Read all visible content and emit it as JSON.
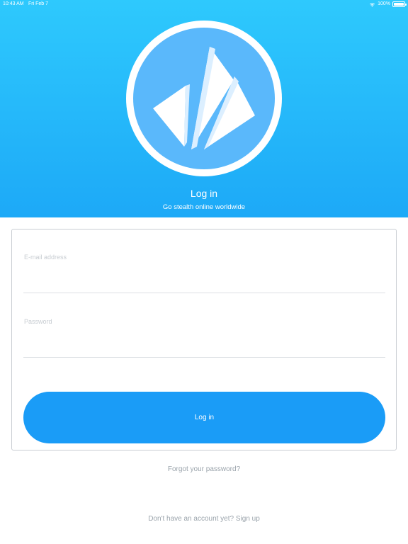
{
  "status_bar": {
    "time": "10:43 AM",
    "date": "Fri Feb 7",
    "battery": "100%",
    "battery_level": 1.0
  },
  "header": {
    "logo_icon": "paper-plane-sails-logo",
    "title": "Log in",
    "subtitle": "Go stealth online worldwide"
  },
  "form": {
    "email_placeholder": "E-mail address",
    "email_value": "",
    "password_placeholder": "Password",
    "password_value": "",
    "login_label": "Log in"
  },
  "links": {
    "forgot_password": "Forgot your password?",
    "signup": "Don't have an account yet? Sign up"
  },
  "colors": {
    "header_top": "#2ec9fd",
    "header_bottom": "#1da9f7",
    "button": "#1a9cf7",
    "logo_disc": "#5ab8fb"
  }
}
